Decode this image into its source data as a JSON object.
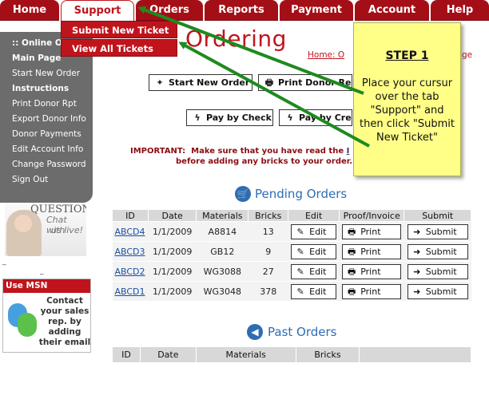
{
  "nav": {
    "tabs": [
      "Home",
      "Support",
      "Orders",
      "Reports",
      "Payment",
      "Account",
      "Help"
    ],
    "active": "Support"
  },
  "dropdown": [
    "Submit New Ticket",
    "View All Tickets"
  ],
  "page": {
    "title": "Ordering",
    "breadcrumb_home": "Home",
    "breadcrumb_rest": ": O",
    "breadcrumb_tail": "ge"
  },
  "sidebar": {
    "online": ":: Online O",
    "main_page": "Main Page",
    "start_new_order": "Start New Order",
    "instructions": "Instructions",
    "print_donor_rpt": "Print Donor Rpt",
    "export_donor_info": "Export Donor Info",
    "donor_payments": "Donor Payments",
    "edit_account_info": "Edit Account Info",
    "change_password": "Change Password",
    "sign_out": "Sign Out"
  },
  "ads": {
    "questions": "QUESTIONS?",
    "chat_line1": "Chat with",
    "chat_line2": "us live!",
    "msn_header": "Use MSN Messenger?",
    "msn_body": "Contact your sales rep. by adding their email"
  },
  "actions": {
    "start_new_order": "Start New Order",
    "print_donor_rep": "Print Donor Rep",
    "pay_by_check": "Pay by Check",
    "pay_by_credit": "Pay by Cre"
  },
  "important": {
    "label": "IMPORTANT:",
    "text1": "Make sure that you have read the",
    "link": "I",
    "text2": "before adding any bricks to your order."
  },
  "pending": {
    "title": "Pending Orders",
    "headers": [
      "ID",
      "Date",
      "Materials",
      "Bricks",
      "Edit",
      "Proof/Invoice",
      "Submit"
    ],
    "rows": [
      {
        "id": "ABCD4",
        "date": "1/1/2009",
        "materials": "A8814",
        "bricks": "13"
      },
      {
        "id": "ABCD3",
        "date": "1/1/2009",
        "materials": "GB12",
        "bricks": "9"
      },
      {
        "id": "ABCD2",
        "date": "1/1/2009",
        "materials": "WG3088",
        "bricks": "27"
      },
      {
        "id": "ABCD1",
        "date": "1/1/2009",
        "materials": "WG3048",
        "bricks": "378"
      }
    ],
    "edit_label": "Edit",
    "print_label": "Print",
    "submit_label": "Submit"
  },
  "past": {
    "title": "Past Orders",
    "headers": [
      "ID",
      "Date",
      "Materials",
      "Bricks"
    ]
  },
  "step": {
    "heading": "STEP 1",
    "text": "Place your cursur over the tab \"Support\" and then click \"Submit New Ticket\""
  },
  "colors": {
    "brand_red": "#c0141c",
    "nav_red": "#a40f17",
    "sidebar_gray": "#6c6c6c",
    "link_blue": "#2e6db4",
    "arrow_green": "#1f8a1f",
    "step_yellow": "#ffff88"
  }
}
